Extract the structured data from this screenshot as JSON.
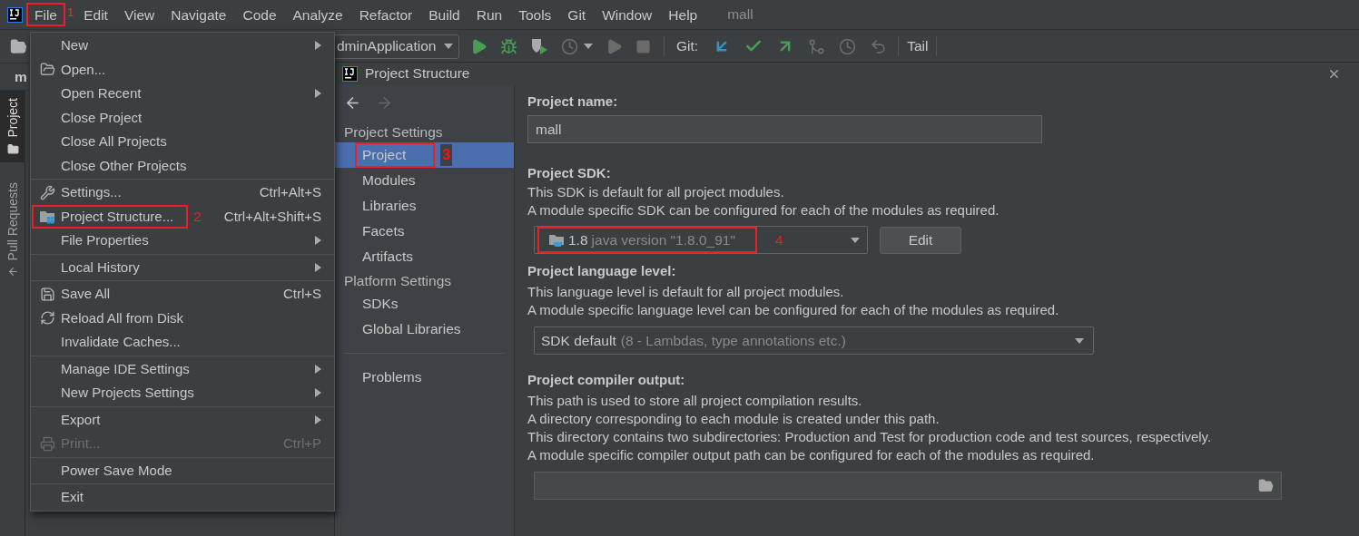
{
  "menu_bar": {
    "items": [
      {
        "label": "File",
        "annotated": true,
        "annotation": "1"
      },
      {
        "label": "Edit",
        "annotated": false
      },
      {
        "label": "View",
        "annotated": false
      },
      {
        "label": "Navigate",
        "annotated": false
      },
      {
        "label": "Code",
        "annotated": false
      },
      {
        "label": "Analyze",
        "annotated": false
      },
      {
        "label": "Refactor",
        "annotated": false
      },
      {
        "label": "Build",
        "annotated": false
      },
      {
        "label": "Run",
        "annotated": false
      },
      {
        "label": "Tools",
        "annotated": false
      },
      {
        "label": "Git",
        "annotated": false
      },
      {
        "label": "Window",
        "annotated": false
      },
      {
        "label": "Help",
        "annotated": false
      }
    ],
    "project_name": "mall"
  },
  "toolbar": {
    "run_config": "dminApplication",
    "vcs_label": "Git:",
    "tail_button": "Tail"
  },
  "editor_tab": "m",
  "tool_windows": [
    {
      "label": "Project",
      "selected": true
    },
    {
      "label": "Pull Requests",
      "selected": false
    }
  ],
  "file_menu": {
    "groups": [
      [
        {
          "label": "New",
          "submenu": true
        },
        {
          "label": "Open...",
          "submenu": false
        },
        {
          "label": "Open Recent",
          "submenu": true
        },
        {
          "label": "Close Project",
          "submenu": false
        },
        {
          "label": "Close All Projects",
          "submenu": false
        },
        {
          "label": "Close Other Projects",
          "submenu": false
        }
      ],
      [
        {
          "label": "Settings...",
          "shortcut": "Ctrl+Alt+S",
          "submenu": false
        },
        {
          "label": "Project Structure...",
          "shortcut": "Ctrl+Alt+Shift+S",
          "submenu": false,
          "annotated": true,
          "annotation": "2"
        },
        {
          "label": "File Properties",
          "submenu": true
        }
      ],
      [
        {
          "label": "Local History",
          "submenu": true
        }
      ],
      [
        {
          "label": "Save All",
          "shortcut": "Ctrl+S",
          "submenu": false
        },
        {
          "label": "Reload All from Disk",
          "submenu": false
        },
        {
          "label": "Invalidate Caches...",
          "submenu": false
        }
      ],
      [
        {
          "label": "Manage IDE Settings",
          "submenu": true
        },
        {
          "label": "New Projects Settings",
          "submenu": true
        }
      ],
      [
        {
          "label": "Export",
          "submenu": true,
          "disabled": false
        },
        {
          "label": "Print...",
          "shortcut": "Ctrl+P",
          "submenu": false,
          "disabled": true
        }
      ],
      [
        {
          "label": "Power Save Mode",
          "submenu": false
        }
      ],
      [
        {
          "label": "Exit",
          "submenu": false
        }
      ]
    ]
  },
  "dialog": {
    "title": "Project Structure",
    "nav": {
      "sections": [
        {
          "heading": "Project Settings",
          "items": [
            {
              "label": "Project",
              "selected": true,
              "annotated": true,
              "annotation": "3"
            },
            {
              "label": "Modules",
              "selected": false
            },
            {
              "label": "Libraries",
              "selected": false
            },
            {
              "label": "Facets",
              "selected": false
            },
            {
              "label": "Artifacts",
              "selected": false
            }
          ]
        },
        {
          "heading": "Platform Settings",
          "items": [
            {
              "label": "SDKs",
              "selected": false
            },
            {
              "label": "Global Libraries",
              "selected": false
            }
          ]
        }
      ],
      "footer_items": [
        {
          "label": "Problems",
          "selected": false
        }
      ]
    },
    "project_name": {
      "label": "Project name:",
      "value": "mall"
    },
    "sdk": {
      "label": "Project SDK:",
      "description": [
        "This SDK is default for all project modules.",
        "A module specific SDK can be configured for each of the modules as required."
      ],
      "value": "1.8",
      "detail": "java version \"1.8.0_91\"",
      "annotated": true,
      "annotation": "4",
      "edit_button": "Edit"
    },
    "language_level": {
      "label": "Project language level:",
      "description": [
        "This language level is default for all project modules.",
        "A module specific language level can be configured for each of the modules as required."
      ],
      "value": "SDK default",
      "detail": "(8 - Lambdas, type annotations etc.)"
    },
    "compiler_output": {
      "label": "Project compiler output:",
      "description": [
        "This path is used to store all project compilation results.",
        "A directory corresponding to each module is created under this path.",
        "This directory contains two subdirectories: Production and Test for production code and test sources, respectively.",
        "A module specific compiler output path can be configured for each of the modules as required."
      ]
    }
  }
}
